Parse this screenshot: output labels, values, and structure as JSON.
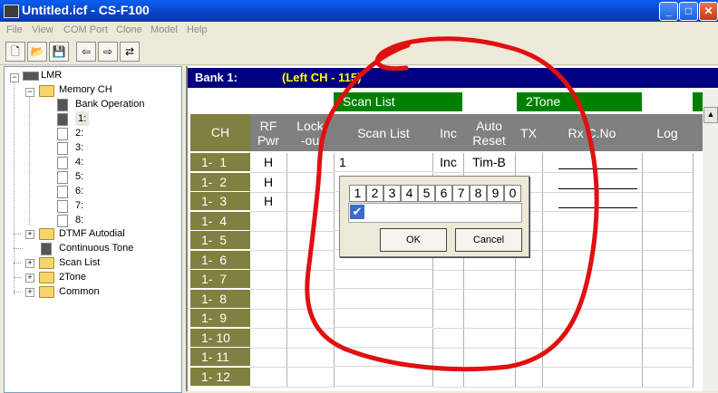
{
  "window": {
    "title": "Untitled.icf  -  CS-F100"
  },
  "menu": [
    "File",
    "View",
    "COM Port",
    "Clone",
    "Model",
    "Help"
  ],
  "toolbar": {
    "icons": [
      "new-file-icon",
      "open-folder-icon",
      "save-icon",
      "read-radio-icon",
      "write-radio-icon",
      "clone-radio-icon"
    ]
  },
  "tree": {
    "root": "LMR",
    "memory_ch": "Memory CH",
    "bank_operation": "Bank Operation",
    "banks": [
      "1:",
      "2:",
      "3:",
      "4:",
      "5:",
      "6:",
      "7:",
      "8:"
    ],
    "dtmf": "DTMF Autodial",
    "continuous_tone": "Continuous Tone",
    "scan_list": "Scan List",
    "two_tone": "2Tone",
    "common": "Common"
  },
  "grid": {
    "bank_label": "Bank 1:",
    "bank_detail": "(Left CH - 115)",
    "group_scan": "Scan List",
    "group_2tone": "2Tone",
    "headers": {
      "ch": "CH",
      "rf_pwr_1": "RF",
      "rf_pwr_2": "Pwr",
      "lockout_1": "Lock",
      "lockout_2": "-ou",
      "scan_list": "Scan List",
      "inc": "Inc",
      "auto_1": "Auto",
      "auto_2": "Reset",
      "tx": "TX",
      "rxc": "Rx C.No",
      "log": "Log"
    },
    "rows": [
      {
        "ch": "1-  1",
        "rf": "H",
        "scan": "1",
        "inc": "Inc",
        "auto": "Tim-B"
      },
      {
        "ch": "1-  2",
        "rf": "H",
        "scan": "",
        "inc": "",
        "auto": ""
      },
      {
        "ch": "1-  3",
        "rf": "H",
        "scan": "",
        "inc": "",
        "auto": ""
      },
      {
        "ch": "1-  4",
        "rf": "",
        "scan": "",
        "inc": "",
        "auto": ""
      },
      {
        "ch": "1-  5",
        "rf": "",
        "scan": "",
        "inc": "",
        "auto": ""
      },
      {
        "ch": "1-  6",
        "rf": "",
        "scan": "",
        "inc": "",
        "auto": ""
      },
      {
        "ch": "1-  7",
        "rf": "",
        "scan": "",
        "inc": "",
        "auto": ""
      },
      {
        "ch": "1-  8",
        "rf": "",
        "scan": "",
        "inc": "",
        "auto": ""
      },
      {
        "ch": "1-  9",
        "rf": "",
        "scan": "",
        "inc": "",
        "auto": ""
      },
      {
        "ch": "1- 10",
        "rf": "",
        "scan": "",
        "inc": "",
        "auto": ""
      },
      {
        "ch": "1- 11",
        "rf": "",
        "scan": "",
        "inc": "",
        "auto": ""
      },
      {
        "ch": "1- 12",
        "rf": "",
        "scan": "",
        "inc": "",
        "auto": ""
      }
    ]
  },
  "popup": {
    "numbers": [
      "1",
      "2",
      "3",
      "4",
      "5",
      "6",
      "7",
      "8",
      "9",
      "0"
    ],
    "checked": [
      true,
      false,
      false,
      false,
      false,
      false,
      false,
      false,
      false,
      false
    ],
    "ok": "OK",
    "cancel": "Cancel"
  },
  "annotation_color": "#e01010"
}
